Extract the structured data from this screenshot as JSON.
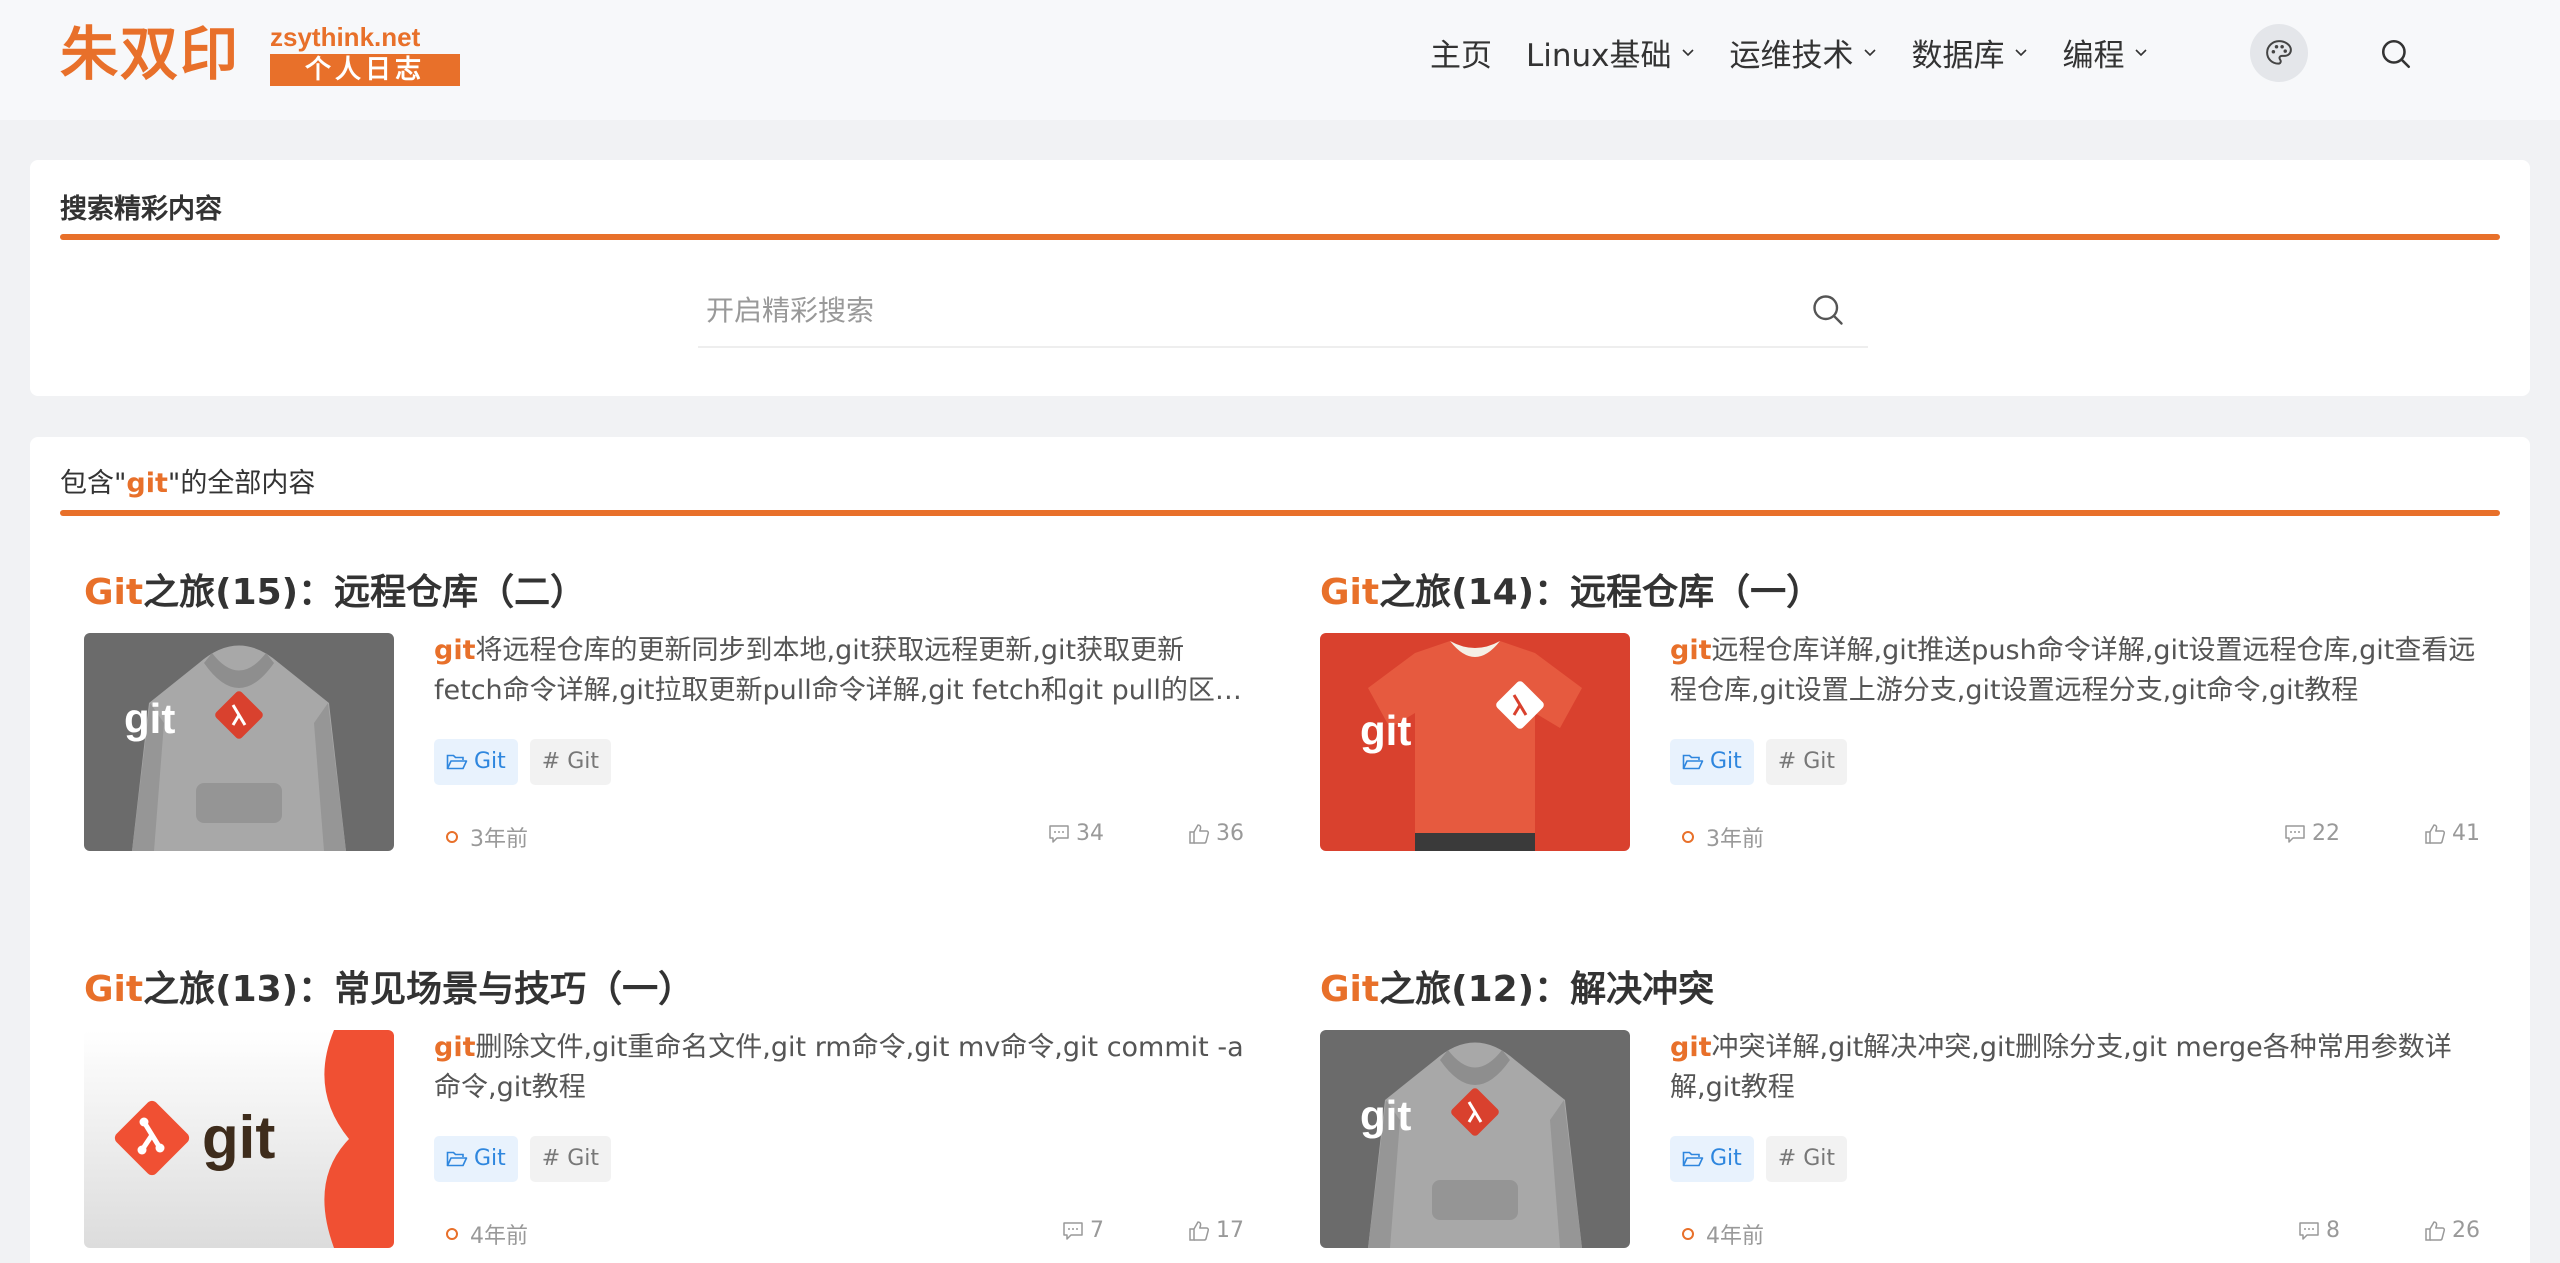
{
  "header": {
    "logo_main": "朱双印",
    "logo_domain": "zsythink.net",
    "logo_sub": "个人日志",
    "nav": [
      {
        "label": "主页",
        "has_dropdown": false
      },
      {
        "label": "Linux基础",
        "has_dropdown": true
      },
      {
        "label": "运维技术",
        "has_dropdown": true
      },
      {
        "label": "数据库",
        "has_dropdown": true
      },
      {
        "label": "编程",
        "has_dropdown": true
      }
    ],
    "theme_icon": "palette-icon",
    "search_icon": "search-icon"
  },
  "search_card": {
    "title": "搜索精彩内容",
    "placeholder": "开启精彩搜索",
    "value": ""
  },
  "results_card": {
    "title_prefix": "包含\"",
    "keyword": "git",
    "title_suffix": "\"的全部内容"
  },
  "posts": [
    {
      "title_hl": "Git",
      "title_rest": "之旅(15)：远程仓库（二）",
      "thumb": "gray-hoodie",
      "excerpt_hl": "git",
      "excerpt_rest": "将远程仓库的更新同步到本地,git获取远程更新,git获取更新fetch命令详解,git拉取更新pull命令详解,git fetch和git pull的区别,git教程",
      "category": "Git",
      "tag": "# Git",
      "time": "3年前",
      "comments": "34",
      "likes": "36"
    },
    {
      "title_hl": "Git",
      "title_rest": "之旅(14)：远程仓库（一）",
      "thumb": "red-tshirt",
      "excerpt_hl": "git",
      "excerpt_rest": "远程仓库详解,git推送push命令详解,git设置远程仓库,git查看远程仓库,git设置上游分支,git设置远程分支,git命令,git教程",
      "category": "Git",
      "tag": "# Git",
      "time": "3年前",
      "comments": "22",
      "likes": "41"
    },
    {
      "title_hl": "Git",
      "title_rest": "之旅(13)：常见场景与技巧（一）",
      "thumb": "git-logo",
      "excerpt_hl": "git",
      "excerpt_rest": "删除文件,git重命名文件,git rm命令,git mv命令,git commit -a命令,git教程",
      "category": "Git",
      "tag": "# Git",
      "time": "4年前",
      "comments": "7",
      "likes": "17"
    },
    {
      "title_hl": "Git",
      "title_rest": "之旅(12)：解决冲突",
      "thumb": "gray-hoodie",
      "excerpt_hl": "git",
      "excerpt_rest": "冲突详解,git解决冲突,git删除分支,git merge各种常用参数详解,git教程",
      "category": "Git",
      "tag": "# Git",
      "time": "4年前",
      "comments": "8",
      "likes": "26"
    }
  ],
  "thumb_text": "git",
  "colors": {
    "accent": "#e8702a",
    "category_blue": "#2e86de",
    "git_red": "#d9412e"
  }
}
